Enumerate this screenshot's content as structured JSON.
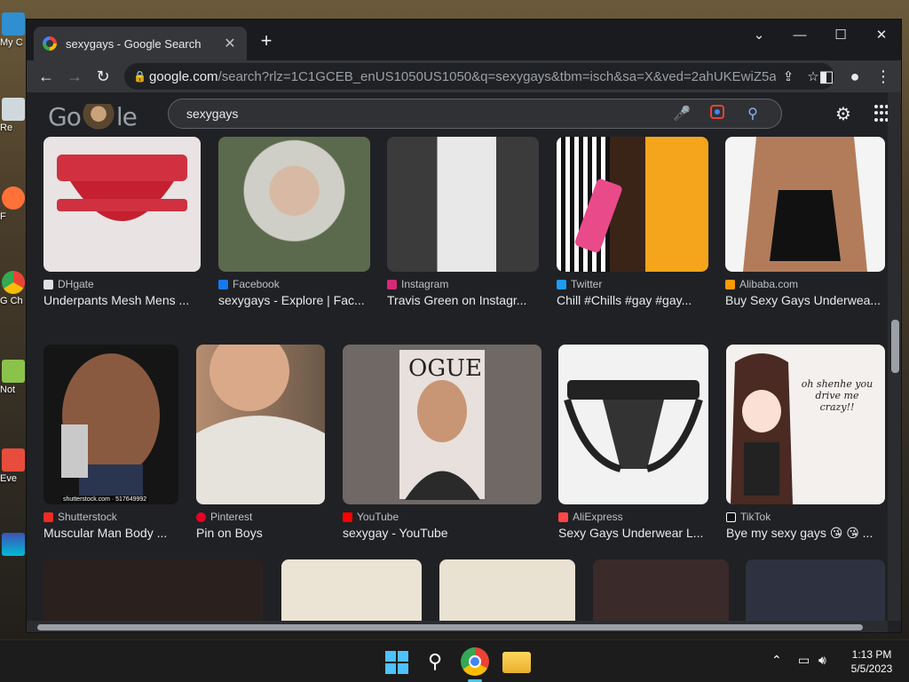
{
  "desktop": {
    "icons": [
      "My C",
      "Re",
      "F",
      "G Ch",
      "Not",
      "Eve"
    ]
  },
  "browser": {
    "tab_title": "sexygays - Google Search",
    "tab_close": "✕",
    "new_tab": "+",
    "url_host": "google.com",
    "url_path": "/search?rlz=1C1GCEB_enUS1050US1050&q=sexygays&tbm=isch&sa=X&ved=2ahUKEwiZ5a7..."
  },
  "search": {
    "logo_text_a": "Go",
    "logo_text_b": "le",
    "query": "sexygays"
  },
  "results": [
    {
      "source": "DHgate",
      "title": "Underpants Mesh Mens ...",
      "fav": "#e0e0e0",
      "bg": "#e9e3e3"
    },
    {
      "source": "Facebook",
      "title": "sexygays - Explore | Fac...",
      "fav": "#1877f2",
      "bg": "#6c6e5a"
    },
    {
      "source": "Instagram",
      "title": "Travis Green on Instagr...",
      "fav": "#d62976",
      "bg": "#3b3b3b"
    },
    {
      "source": "Twitter",
      "title": "Chill #Chills #gay #gay...",
      "fav": "#1d9bf0",
      "bg": "#222"
    },
    {
      "source": "Alibaba.com",
      "title": "Buy Sexy Gays Underwea...",
      "fav": "#ff9a00",
      "bg": "#f4f4f4"
    },
    {
      "source": "Shutterstock",
      "title": "Muscular Man Body ...",
      "fav": "#ee2b24",
      "bg": "#151515",
      "caption": "shutterstock.com · 517649992"
    },
    {
      "source": "Pinterest",
      "title": "Pin on Boys",
      "fav": "#e60023",
      "bg": "#8a6a55"
    },
    {
      "source": "YouTube",
      "title": "sexygay - YouTube",
      "fav": "#ff0000",
      "bg": "#6f6864",
      "overlay": "OGUE"
    },
    {
      "source": "AliExpress",
      "title": "Sexy Gays Underwear L...",
      "fav": "#ff4747",
      "bg": "#f2f2f2"
    },
    {
      "source": "TikTok",
      "title": "Bye my sexy gays 😘 😘 ...",
      "fav": "#111",
      "bg": "#f4f0ee",
      "caption": "oh shenhe you drive me crazy!!"
    }
  ],
  "row3_colors": [
    "#2a211e",
    "#ebe3d4",
    "#e9e1d1",
    "#3b2a2a",
    "#2e3240"
  ],
  "taskbar": {
    "time": "1:13 PM",
    "date": "5/5/2023"
  }
}
